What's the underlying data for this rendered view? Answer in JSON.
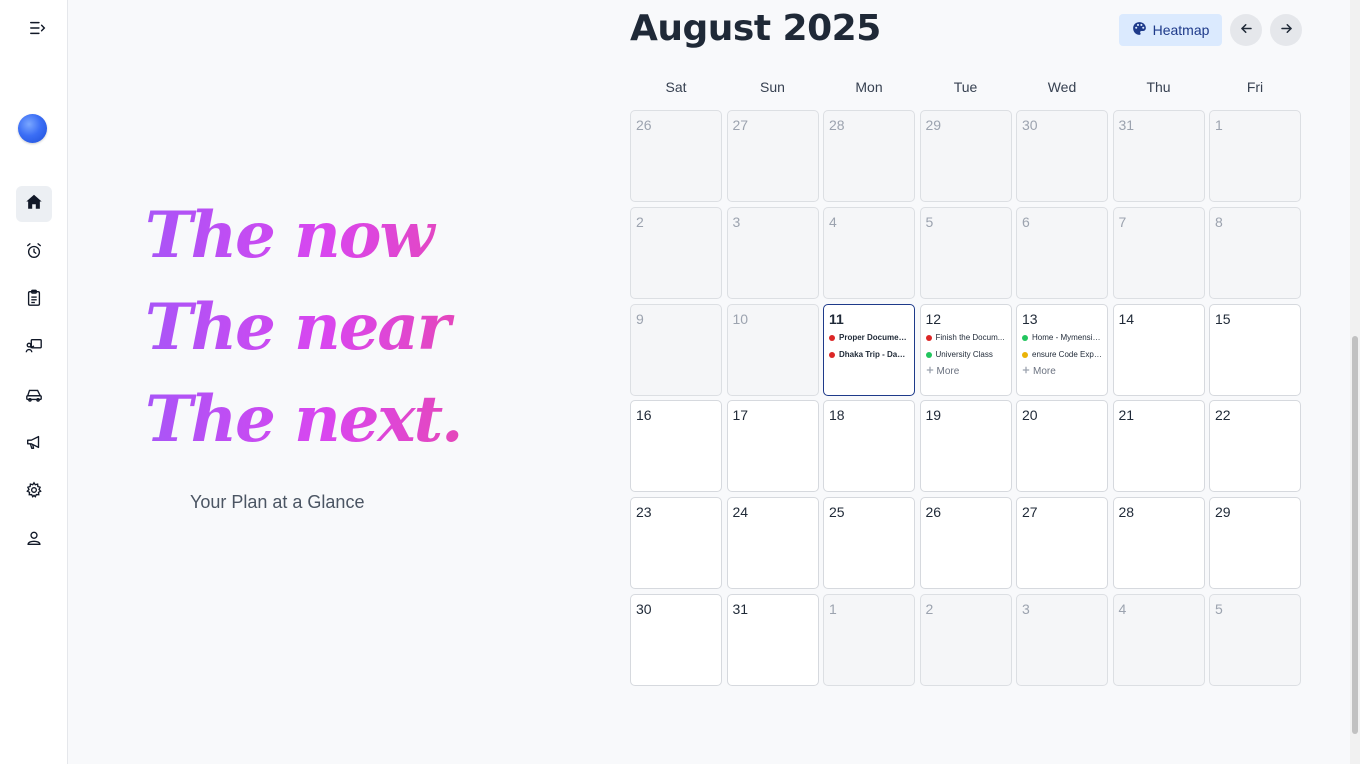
{
  "sidebar": {
    "items": [
      {
        "name": "home-icon",
        "active": true
      },
      {
        "name": "alarm-clock-icon",
        "active": false
      },
      {
        "name": "clipboard-icon",
        "active": false
      },
      {
        "name": "presentation-icon",
        "active": false
      },
      {
        "name": "car-icon",
        "active": false
      },
      {
        "name": "megaphone-icon",
        "active": false
      },
      {
        "name": "gear-icon",
        "active": false
      },
      {
        "name": "user-icon",
        "active": false
      }
    ]
  },
  "hero": {
    "lines": [
      "The now",
      "The near",
      "The next."
    ],
    "tagline": "Your Plan at a Glance"
  },
  "calendar": {
    "month_title": "August 2025",
    "heatmap_label": "Heatmap",
    "weekdays": [
      "Sat",
      "Sun",
      "Mon",
      "Tue",
      "Wed",
      "Thu",
      "Fri"
    ],
    "weeks": [
      [
        {
          "d": "26",
          "out": true
        },
        {
          "d": "27",
          "out": true
        },
        {
          "d": "28",
          "out": true
        },
        {
          "d": "29",
          "out": true
        },
        {
          "d": "30",
          "out": true
        },
        {
          "d": "31",
          "out": true
        },
        {
          "d": "1",
          "out": true
        }
      ],
      [
        {
          "d": "2",
          "out": true
        },
        {
          "d": "3",
          "out": true
        },
        {
          "d": "4",
          "out": true
        },
        {
          "d": "5",
          "out": true
        },
        {
          "d": "6",
          "out": true
        },
        {
          "d": "7",
          "out": true
        },
        {
          "d": "8",
          "out": true
        }
      ],
      [
        {
          "d": "9",
          "out": true
        },
        {
          "d": "10",
          "out": true
        },
        {
          "d": "11",
          "today": true,
          "events": [
            {
              "text": "Proper Documen...",
              "color": "#dc2626",
              "bold": true
            },
            {
              "text": "Dhaka Trip - Day ...",
              "color": "#dc2626",
              "bold": true
            }
          ]
        },
        {
          "d": "12",
          "events": [
            {
              "text": "Finish the Docum...",
              "color": "#dc2626"
            },
            {
              "text": "University Class",
              "color": "#22c55e"
            }
          ],
          "more": "More"
        },
        {
          "d": "13",
          "events": [
            {
              "text": "Home - Mymensin...",
              "color": "#22c55e"
            },
            {
              "text": "ensure Code Expl...",
              "color": "#eab308"
            }
          ],
          "more": "More"
        },
        {
          "d": "14"
        },
        {
          "d": "15"
        }
      ],
      [
        {
          "d": "16"
        },
        {
          "d": "17"
        },
        {
          "d": "18"
        },
        {
          "d": "19"
        },
        {
          "d": "20"
        },
        {
          "d": "21"
        },
        {
          "d": "22"
        }
      ],
      [
        {
          "d": "23"
        },
        {
          "d": "24"
        },
        {
          "d": "25"
        },
        {
          "d": "26"
        },
        {
          "d": "27"
        },
        {
          "d": "28"
        },
        {
          "d": "29"
        }
      ],
      [
        {
          "d": "30"
        },
        {
          "d": "31"
        },
        {
          "d": "1",
          "out": true
        },
        {
          "d": "2",
          "out": true
        },
        {
          "d": "3",
          "out": true
        },
        {
          "d": "4",
          "out": true
        },
        {
          "d": "5",
          "out": true
        }
      ]
    ]
  }
}
